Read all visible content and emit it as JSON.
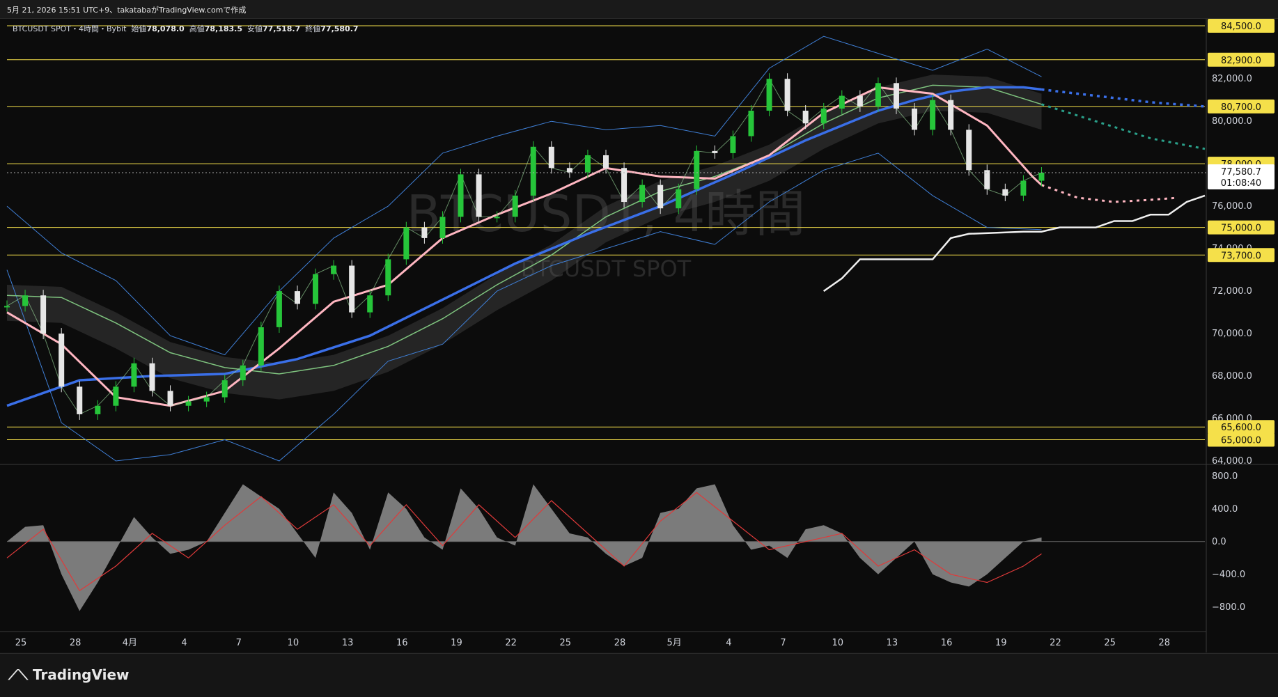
{
  "header": {
    "caption": "5月 21, 2026 15:51 UTC+9、takatabaがTradingView.comで作成"
  },
  "legend": {
    "symbol": "BTCUSDT SPOT・4時間・Bybit",
    "open_label": "始値",
    "open": "78,078.0",
    "high_label": "高値",
    "high": "78,183.5",
    "low_label": "安値",
    "low": "77,518.7",
    "close_label": "終値",
    "close": "77,580.7"
  },
  "watermark": {
    "title": "BTCUSDT, 4時間",
    "subtitle": "BTCUSDT SPOT"
  },
  "footer": {
    "brand": "TradingView"
  },
  "countdown": "01:08:40",
  "colors": {
    "background": "#0c0c0c",
    "up": "#26c53a",
    "down": "#e6e6e6",
    "level": "#f5e04a",
    "ema_fast": "#ffb6c1",
    "ema_slow": "#3a6fe8",
    "ma_mid": "#7fc47f",
    "bb": "#3f7fd6",
    "cloud": "#555555",
    "osc_fill": "#8f8f8f",
    "osc_signal": "#e03a3a"
  },
  "chart_data": [
    {
      "type": "line",
      "title": "BTCUSDT, 4時間",
      "subtitle": "BTCUSDT SPOT",
      "xlabel": "",
      "ylabel": "",
      "x_ticks": [
        "25",
        "28",
        "4月",
        "4",
        "7",
        "10",
        "13",
        "16",
        "19",
        "22",
        "25",
        "28",
        "5月",
        "4",
        "7",
        "10",
        "13",
        "16",
        "19",
        "22",
        "25",
        "28"
      ],
      "y_ticks": [
        64000,
        66000,
        68000,
        70000,
        72000,
        74000,
        76000,
        78000,
        80000,
        82000
      ],
      "y_tick_labels": [
        "64,000.0",
        "66,000.0",
        "68,000.0",
        "70,000.0",
        "72,000.0",
        "74,000.0",
        "76,000.0",
        "78,000.0",
        "80,000.0",
        "82,000.0"
      ],
      "ylim": [
        64000,
        84500
      ],
      "x_range_days": [
        0,
        66
      ],
      "horizontal_levels": [
        84500,
        82900,
        80700,
        78000,
        75000,
        73700,
        65600,
        65000
      ],
      "horizontal_level_labels": [
        "84,500.0",
        "82,900.0",
        "80,700.0",
        "78,000.0",
        "75,000.0",
        "73,700.0",
        "65,600.0",
        "65,000.0"
      ],
      "last_price": 77580.7,
      "last_price_label": "77,580.7",
      "price_series": {
        "name": "",
        "x": [
          0,
          1,
          2,
          3,
          4,
          5,
          6,
          7,
          8,
          9,
          10,
          11,
          12,
          13,
          14,
          15,
          16,
          17,
          18,
          19,
          20,
          21,
          22,
          23,
          24,
          25,
          26,
          27,
          28,
          29,
          30,
          31,
          32,
          33,
          34,
          35,
          36,
          37,
          38,
          39,
          40,
          41,
          42,
          43,
          44,
          45,
          46,
          47,
          48,
          49,
          50,
          51,
          52,
          53,
          54,
          55,
          56,
          57
        ],
        "values": [
          71300,
          71800,
          70000,
          67500,
          66200,
          66600,
          67500,
          68600,
          67300,
          66600,
          66800,
          67000,
          67800,
          68500,
          70300,
          72000,
          71400,
          72800,
          73200,
          71000,
          71800,
          73500,
          75000,
          74500,
          75500,
          77500,
          75500,
          75500,
          76500,
          78800,
          77800,
          77600,
          78400,
          77800,
          76200,
          77000,
          75900,
          76800,
          78600,
          78500,
          79300,
          80500,
          82000,
          80500,
          79900,
          80600,
          81200,
          80700,
          81800,
          80600,
          79600,
          81000,
          79600,
          77700,
          76800,
          76500,
          77200,
          77580
        ]
      },
      "ema_fast": {
        "x": [
          0,
          3,
          6,
          9,
          12,
          15,
          18,
          21,
          24,
          27,
          30,
          33,
          36,
          39,
          42,
          45,
          48,
          51,
          54,
          56.5,
          57
        ],
        "values": [
          71000,
          69500,
          67000,
          66600,
          67300,
          69300,
          71500,
          72300,
          74500,
          75600,
          76600,
          77800,
          77400,
          77300,
          78400,
          80400,
          81600,
          81300,
          79800,
          77400,
          77000
        ]
      },
      "ema_fast_projection": {
        "x": [
          57,
          59,
          61,
          63,
          64.5
        ],
        "values": [
          77000,
          76400,
          76200,
          76300,
          76400
        ]
      },
      "ema_slow": {
        "x": [
          0,
          4,
          8,
          12,
          16,
          20,
          24,
          28,
          32,
          36,
          40,
          44,
          48,
          50,
          52,
          54,
          56,
          57
        ],
        "values": [
          66600,
          67800,
          68000,
          68100,
          68800,
          69900,
          71600,
          73300,
          74700,
          76000,
          77500,
          79100,
          80500,
          81000,
          81400,
          81600,
          81600,
          81500
        ]
      },
      "ema_slow_projection": {
        "x": [
          57,
          60,
          63,
          66
        ],
        "values": [
          81500,
          81200,
          80900,
          80700
        ]
      },
      "ma_mid": {
        "x": [
          0,
          3,
          6,
          9,
          12,
          15,
          18,
          21,
          24,
          27,
          30,
          33,
          36,
          39,
          42,
          45,
          48,
          51,
          54,
          57
        ],
        "values": [
          71800,
          71700,
          70500,
          69100,
          68400,
          68100,
          68500,
          69400,
          70700,
          72300,
          73700,
          75500,
          76700,
          77400,
          78400,
          79900,
          81100,
          81700,
          81600,
          80800
        ]
      },
      "ma_mid_projection": {
        "x": [
          57,
          60,
          63,
          66
        ],
        "values": [
          80800,
          80000,
          79200,
          78700
        ]
      },
      "bb_upper": {
        "x": [
          0,
          3,
          6,
          9,
          12,
          15,
          18,
          21,
          24,
          27,
          30,
          33,
          36,
          39,
          42,
          45,
          48,
          51,
          54,
          57
        ],
        "values": [
          76000,
          73800,
          72500,
          69900,
          69000,
          72000,
          74500,
          76000,
          78500,
          79300,
          80000,
          79600,
          79800,
          79300,
          82500,
          84000,
          83200,
          82400,
          83400,
          82100
        ]
      },
      "bb_lower": {
        "x": [
          0,
          3,
          6,
          9,
          12,
          15,
          18,
          21,
          24,
          27,
          30,
          33,
          36,
          39,
          42,
          45,
          48,
          51,
          54,
          57
        ],
        "values": [
          73000,
          65800,
          64000,
          64300,
          65000,
          64000,
          66200,
          68700,
          69500,
          72000,
          73200,
          74000,
          74800,
          74200,
          76200,
          77700,
          78500,
          76500,
          75000,
          74900
        ]
      },
      "oscillator": {
        "y_ticks": [
          -800,
          -400,
          0,
          400,
          800
        ],
        "y_tick_labels": [
          "−800.0",
          "−400.0",
          "0.0",
          "400.0",
          "800.0"
        ],
        "ylim": [
          -1100,
          900
        ],
        "x": [
          0,
          1,
          2,
          3,
          4,
          5,
          6,
          7,
          8,
          9,
          10,
          11,
          12,
          13,
          14,
          15,
          16,
          17,
          18,
          19,
          20,
          21,
          22,
          23,
          24,
          25,
          26,
          27,
          28,
          29,
          30,
          31,
          32,
          33,
          34,
          35,
          36,
          37,
          38,
          39,
          40,
          41,
          42,
          43,
          44,
          45,
          46,
          47,
          48,
          49,
          50,
          51,
          52,
          53,
          54,
          55,
          56,
          57
        ],
        "values": [
          0,
          180,
          200,
          -400,
          -850,
          -500,
          -100,
          300,
          50,
          -150,
          -100,
          0,
          350,
          700,
          550,
          400,
          100,
          -200,
          600,
          350,
          -100,
          600,
          400,
          50,
          -100,
          650,
          400,
          50,
          -50,
          700,
          400,
          100,
          50,
          -150,
          -300,
          -200,
          350,
          400,
          650,
          700,
          200,
          -100,
          -50,
          -200,
          150,
          200,
          100,
          -200,
          -400,
          -200,
          0,
          -400,
          -500,
          -550,
          -400,
          -200,
          0,
          50
        ]
      },
      "oscillator_signal": {
        "x": [
          0,
          2,
          4,
          6,
          8,
          10,
          12,
          14,
          16,
          18,
          20,
          22,
          24,
          26,
          28,
          30,
          32,
          34,
          36,
          38,
          40,
          42,
          44,
          46,
          48,
          50,
          52,
          54,
          56,
          57
        ],
        "values": [
          -200,
          150,
          -600,
          -300,
          100,
          -200,
          200,
          550,
          150,
          450,
          -50,
          450,
          -50,
          450,
          50,
          500,
          100,
          -300,
          250,
          600,
          250,
          -100,
          0,
          100,
          -300,
          -100,
          -400,
          -500,
          -300,
          -150
        ]
      },
      "projection_levels": {
        "x": [
          45,
          46,
          47,
          48,
          51,
          52,
          53,
          56,
          57,
          58,
          60,
          61,
          62,
          63,
          64,
          65,
          66
        ],
        "values": [
          72000,
          72600,
          73500,
          73500,
          73500,
          74500,
          74700,
          74800,
          74800,
          75000,
          75000,
          75300,
          75300,
          75600,
          75600,
          76200,
          76500
        ]
      }
    }
  ]
}
